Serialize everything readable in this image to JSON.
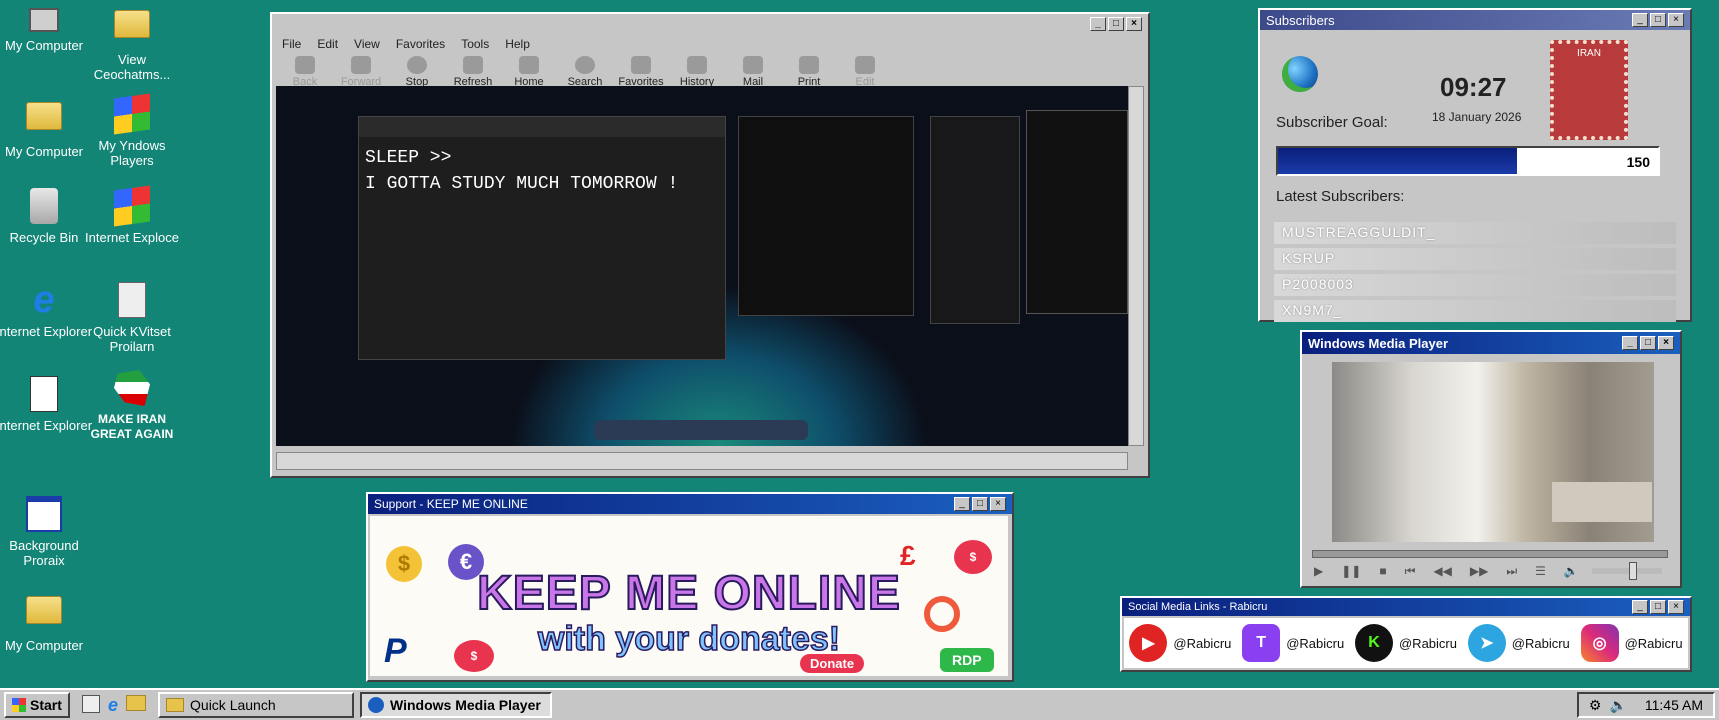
{
  "desktop_icons": [
    {
      "label": "My Computer",
      "name": "my-computer-icon"
    },
    {
      "label": "View Ceochatms...",
      "name": "folder-icon"
    },
    {
      "label": "My Computer",
      "name": "my-documents-icon"
    },
    {
      "label": "My Yndows Players",
      "name": "windows-logo-icon"
    },
    {
      "label": "Recycle Bin",
      "name": "recycle-bin-icon"
    },
    {
      "label": "Internet Exploce",
      "name": "windows-logo-icon"
    },
    {
      "label": "Internet Explorer",
      "name": "internet-explorer-icon"
    },
    {
      "label": "Quick KVitset Proilarn",
      "name": "calculator-icon"
    },
    {
      "label": "Internet Explorer",
      "name": "document-icon"
    },
    {
      "label": "MAKE IRAN GREAT AGAIN",
      "name": "iran-map-icon"
    },
    {
      "label": "Background Proraix",
      "name": "window-icon"
    },
    {
      "label": "My Computer",
      "name": "folder-icon"
    }
  ],
  "browser": {
    "menu": [
      "File",
      "Edit",
      "View",
      "Favorites",
      "Tools",
      "Help"
    ],
    "toolbar": [
      "Back",
      "Forward",
      "Stop",
      "Refresh",
      "Home",
      "Search",
      "Favorites",
      "History",
      "Mail",
      "Print",
      "Edit"
    ],
    "stream_text_1": "SLEEP >>",
    "stream_text_2": "I GOTTA STUDY MUCH TOMORROW !"
  },
  "subscribers": {
    "title": "Subscribers",
    "time": "09:27",
    "date": "18 January 2026",
    "goal_label": "Subscriber Goal:",
    "goal_value": "150",
    "goal_progress": 0.63,
    "latest_label": "Latest Subscribers:",
    "latest": [
      "MUSTREAGGULDIT_",
      "KSRUP",
      "P2008003",
      "XN9M7_"
    ],
    "stamp_text": "IRAN"
  },
  "media_player": {
    "title": "Windows Media Player",
    "volume": 0.6
  },
  "support": {
    "title": "Support - KEEP ME ONLINE",
    "headline": "KEEP ME ONLINE",
    "subline": "with your donates!",
    "donate": "Donate",
    "rdp": "RDP"
  },
  "social": {
    "title": "Social Media Links - Rabicru",
    "items": [
      {
        "handle": "@Rabicru",
        "icon": "youtube-icon",
        "color": "#e02424"
      },
      {
        "handle": "@Rabicru",
        "icon": "twitch-icon",
        "color": "#8a3ff0"
      },
      {
        "handle": "@Rabicru",
        "icon": "kick-icon",
        "color": "#1aca2a"
      },
      {
        "handle": "@Rabicru",
        "icon": "telegram-icon",
        "color": "#2ca5e0"
      },
      {
        "handle": "@Rabicru",
        "icon": "instagram-icon",
        "color": "#d62976"
      }
    ]
  },
  "taskbar": {
    "start": "Start",
    "quick_launch": "Quick Launch",
    "active_window": "Windows Media Player",
    "clock": "11:45 AM"
  }
}
